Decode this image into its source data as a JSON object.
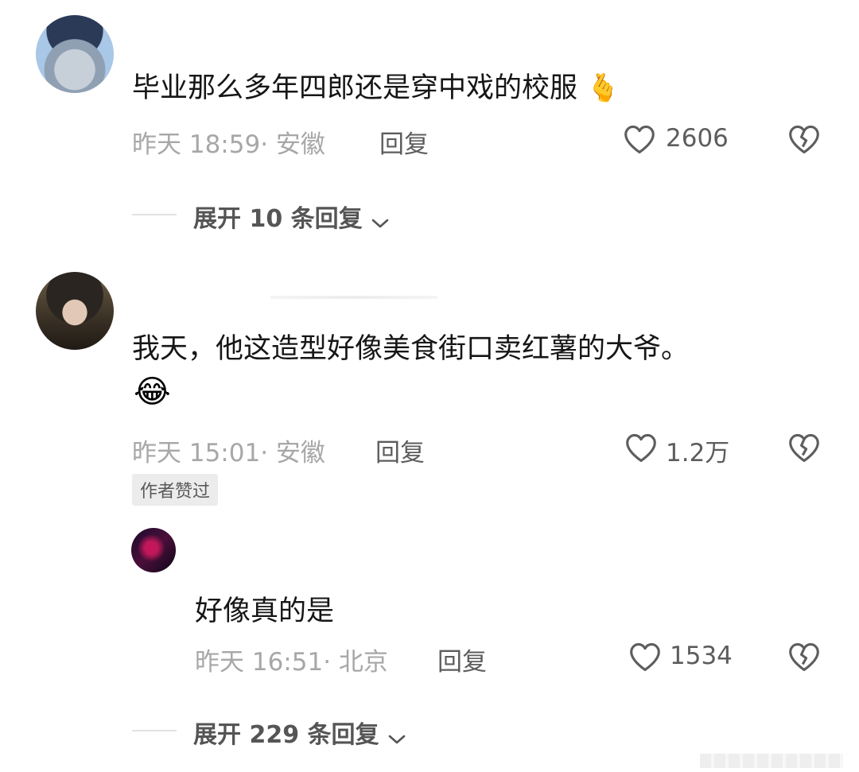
{
  "comments": [
    {
      "text": "毕业那么多年四郎还是穿中戏的校服",
      "emoji": "🫰",
      "time": "昨天 18:59· 安徽",
      "reply_label": "回复",
      "likes": "2606",
      "expand_label": "展开 10 条回复"
    },
    {
      "text": "我天，他这造型好像美食街口卖红薯的大爷。",
      "emoji": "😂",
      "time": "昨天 15:01· 安徽",
      "reply_label": "回复",
      "likes": "1.2万",
      "badge": "作者赞过",
      "replies": [
        {
          "text": "好像真的是",
          "time": "昨天 16:51· 北京",
          "reply_label": "回复",
          "likes": "1534"
        }
      ],
      "expand_label": "展开 229 条回复"
    }
  ],
  "icons": {
    "like": "heart-outline-icon",
    "dislike": "broken-heart-icon",
    "expand": "chevron-down-icon"
  },
  "colors": {
    "text": "#161616",
    "meta": "#a7a7a7",
    "secondary": "#5d5d5d"
  }
}
